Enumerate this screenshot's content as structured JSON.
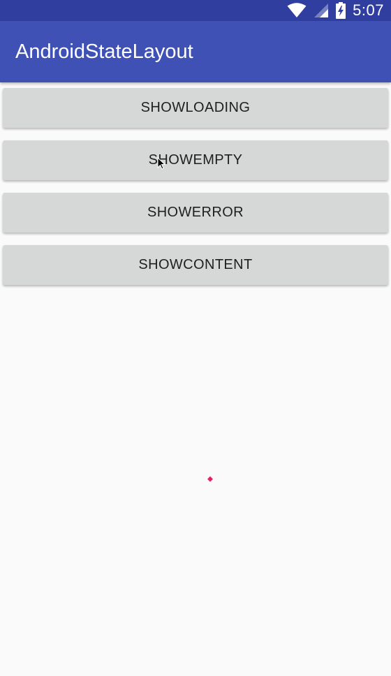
{
  "status_bar": {
    "time": "5:07",
    "icons": [
      "wifi-icon",
      "cell-signal-icon",
      "battery-charging-icon"
    ],
    "color": "#303f9f"
  },
  "toolbar": {
    "title": "AndroidStateLayout",
    "color": "#3f51b5"
  },
  "buttons": [
    {
      "label": "SHOWLOADING"
    },
    {
      "label": "SHOWEMPTY"
    },
    {
      "label": "SHOWERROR"
    },
    {
      "label": "SHOWCONTENT"
    }
  ],
  "loading_indicator": {
    "icon": "progress-spinner-icon",
    "color": "#e91e63"
  },
  "pointer": {
    "icon": "mouse-cursor-icon"
  }
}
